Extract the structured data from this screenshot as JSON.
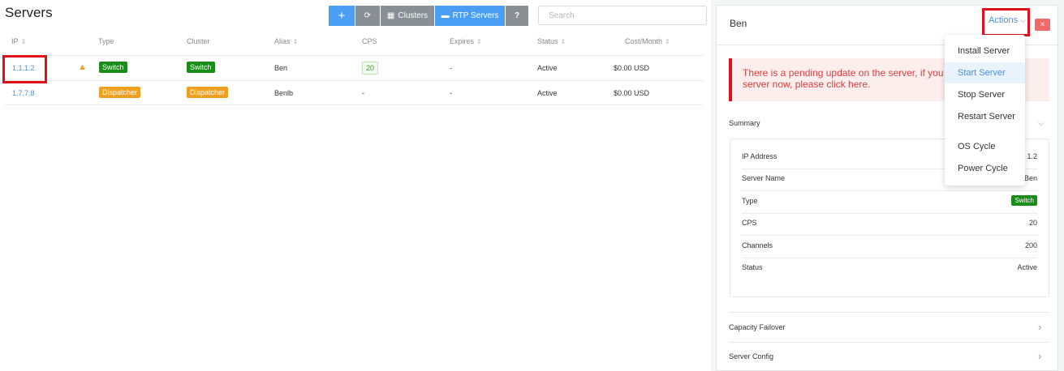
{
  "page": {
    "title": "Servers"
  },
  "toolbar": {
    "add_label": "+",
    "refresh_label": "⟳",
    "clusters_label": "Clusters",
    "rtp_label": "RTP Servers",
    "help_label": "?"
  },
  "search": {
    "placeholder": "Search",
    "value": ""
  },
  "table": {
    "headers": {
      "ip": "IP",
      "type": "Type",
      "cluster": "Cluster",
      "alias": "Alias",
      "cps": "CPS",
      "expires": "Expires",
      "status": "Status",
      "cost": "Cost/Month"
    },
    "rows": [
      {
        "ip": "1.1.1.2",
        "warning": true,
        "type": "Switch",
        "cluster": "Switch",
        "alias": "Ben",
        "cps": "20",
        "expires": "-",
        "status": "Active",
        "cost": "$0.00 USD"
      },
      {
        "ip": "1.7.7.8",
        "warning": false,
        "type": "Dispatcher",
        "cluster": "Dispatcher",
        "alias": "Benlb",
        "cps": "-",
        "expires": "-",
        "status": "Active",
        "cost": "$0.00 USD"
      }
    ]
  },
  "panel": {
    "title": "Ben",
    "actions_label": "Actions",
    "close_label": "×",
    "alert_line1": "There is a pending update on the server, if you",
    "alert_line2": "server now, please click here.",
    "summary_title": "Summary",
    "summary": {
      "ip_label": "IP Address",
      "ip_value": "1.2",
      "name_label": "Server Name",
      "name_value": "Ben",
      "type_label": "Type",
      "type_value": "Switch",
      "cps_label": "CPS",
      "cps_value": "20",
      "channels_label": "Channels",
      "channels_value": "200",
      "status_label": "Status",
      "status_value": "Active"
    },
    "capacity_failover": "Capacity Failover",
    "server_config": "Server Config"
  },
  "actions_menu": {
    "items": [
      "Install Server",
      "Start Server",
      "Stop Server",
      "Restart Server",
      "OS Cycle",
      "Power Cycle"
    ],
    "active_item": "Start Server"
  },
  "colors": {
    "primary": "#4a9ff5",
    "switch_badge": "#1a8c1a",
    "dispatcher_badge": "#f0a020",
    "highlight": "#e0101b",
    "alert_bg": "#fdeeee",
    "alert_text": "#e03b3b"
  },
  "icons": {
    "sort": "sort-icon",
    "warning": "warning-icon",
    "refresh": "refresh-icon",
    "clusters": "grid-icon",
    "rtp": "server-icon",
    "chevron": "chevron-icon",
    "close": "close-icon"
  }
}
